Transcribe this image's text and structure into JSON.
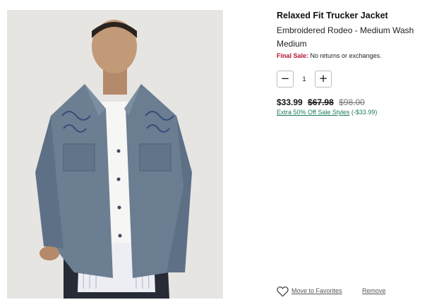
{
  "product": {
    "title": "Relaxed Fit Trucker Jacket",
    "variant": "Embroidered Rodeo - Medium Wash",
    "size": "Medium",
    "final_sale_label": "Final Sale:",
    "final_sale_text": "No returns or exchanges."
  },
  "quantity": {
    "minus_label": "−",
    "value": "1",
    "plus_label": "+"
  },
  "pricing": {
    "sale_price": "$33.99",
    "was_price": "$67.98",
    "original_price": "$98.00",
    "promo_link": "Extra 50% Off Sale Styles",
    "promo_savings": "(-$33.99)"
  },
  "actions": {
    "favorites_label": "Move to Favorites",
    "remove_label": "Remove"
  },
  "icons": {
    "favorite": "heart-outline-icon"
  },
  "colors": {
    "final_sale_red": "#b3142c",
    "promo_green": "#1a7a5a",
    "image_background": "#e6e5e2",
    "denim": "#6c7e92"
  }
}
